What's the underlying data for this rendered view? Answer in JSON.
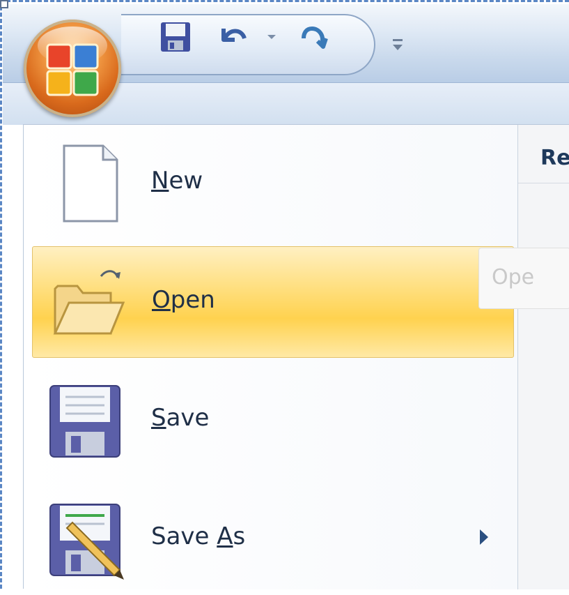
{
  "window": {
    "recent_heading": "Re",
    "tooltip": "Ope"
  },
  "menu": {
    "items": [
      {
        "before": "",
        "key": "N",
        "after": "ew",
        "icon": "new-document-icon",
        "state": "normal"
      },
      {
        "before": "",
        "key": "O",
        "after": "pen",
        "icon": "open-folder-icon",
        "state": "hover"
      },
      {
        "before": "",
        "key": "S",
        "after": "ave",
        "icon": "save-floppy-icon",
        "state": "normal"
      },
      {
        "before": "Save ",
        "key": "A",
        "after": "s",
        "icon": "save-as-floppy-pencil-icon",
        "state": "normal"
      }
    ]
  },
  "colors": {
    "highlight": "#ffd24f",
    "orb": "#d96a1c",
    "title_bar": "#c9d9ec",
    "text": "#1f2f47"
  }
}
